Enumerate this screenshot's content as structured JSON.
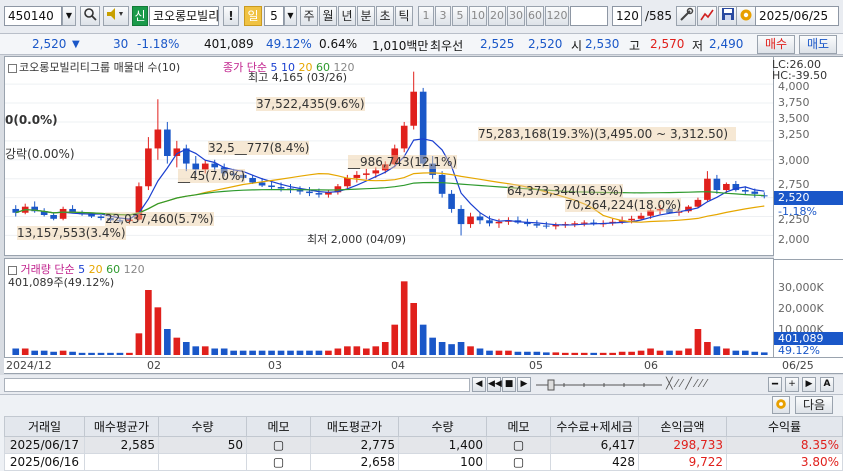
{
  "toolbar": {
    "code": "450140",
    "mode_badge": "신",
    "stock_name": "코오롱모빌리",
    "excl": "!",
    "period_active": "일",
    "period_value": "5",
    "periods": [
      "주",
      "월",
      "년",
      "분",
      "초",
      "틱"
    ],
    "minute_options": [
      "1",
      "3",
      "5",
      "10",
      "20",
      "30",
      "60",
      "120"
    ],
    "counter": "120",
    "counter_total": "/585",
    "date": "2025/06/25"
  },
  "quote": {
    "price": "2,520",
    "arrow": "▼",
    "change": "30",
    "change_pct": "-1.18%",
    "volume": "401,089",
    "vol_ratio": "49.12%",
    "turnover": "0.64%",
    "amount": "1,010백만",
    "best_bid_label": "최우선",
    "best_ask": "2,525",
    "best_bid": "2,520",
    "open_label": "시",
    "open": "2,530",
    "high_label": "고",
    "high": "2,570",
    "low_label": "저",
    "low": "2,490",
    "buy_btn": "매수",
    "sell_btn": "매도"
  },
  "legend": {
    "title": "코오롱모빌리티그룹 매물대 수(10)",
    "ma_label": "종가 단순",
    "ma5": "5",
    "ma10": "10",
    "ma20": "20",
    "ma60": "60",
    "ma120": "120",
    "lc": "LC:26.00",
    "hc": "HC:-39.50"
  },
  "annotations": {
    "high": "최고 4,165 (03/26)",
    "low": "최저 2,000 (04/09)",
    "fall": "강락(0.00%)",
    "left_zero": "0(0.0%)",
    "p1": "37,522,435(9.6%)",
    "p2": "75,283,168(19.3%)(3,495.00 ~ 3,312.50)",
    "p3": "32,5__777(8.4%)",
    "p4": "__986,743(12.1%)",
    "p5": "__45(7.0%)",
    "p6": "64,373,344(16.5%)",
    "p7": "70,264,224(18.0%)",
    "p8": "22,037,460(5.7%)",
    "p9": "13,157,553(3.4%)"
  },
  "price_axis": {
    "ticks": [
      "4,000",
      "3,750",
      "3,500",
      "3,250",
      "3,000",
      "2,750",
      "2,500",
      "2,250",
      "2,000"
    ],
    "current": "2,520",
    "current_pct": "-1.18%"
  },
  "volume_legend": {
    "title": "거래량",
    "ma_label": "단순",
    "ma5": "5",
    "ma20": "20",
    "ma60": "60",
    "ma120": "120",
    "value": "401,089주(49.12%)"
  },
  "volume_axis": {
    "ticks": [
      "30,000K",
      "20,000K",
      "10,000K"
    ],
    "current": "401,089",
    "current_pct": "49.12%"
  },
  "dates": [
    "2024/12",
    "02",
    "03",
    "04",
    "05",
    "06",
    "06/25"
  ],
  "trades": {
    "next_btn": "다음",
    "headers": [
      "거래일",
      "매수평균가",
      "수량",
      "메모",
      "매도평균가",
      "수량",
      "메모",
      "수수료+제세금",
      "손익금액",
      "수익률"
    ],
    "rows": [
      [
        "2025/06/17",
        "2,585",
        "50",
        "",
        "2,775",
        "1,400",
        "",
        "6,417",
        "298,733",
        "8.35%"
      ],
      [
        "2025/06/16",
        "",
        "",
        "",
        "2,658",
        "100",
        "",
        "428",
        "9,722",
        "3.80%"
      ]
    ]
  },
  "colors": {
    "up": "#e0201c",
    "down": "#1a57c8",
    "ma5": "#1a3fd0",
    "ma20": "#e6a700",
    "ma60": "#2e9a2e",
    "ma120": "#888888"
  },
  "chart_data": {
    "type": "candlestick",
    "y_range": [
      1900,
      4200
    ],
    "vol_range": [
      0,
      36000
    ],
    "bars": [
      [
        2350,
        2400,
        2250,
        2300,
        3
      ],
      [
        2300,
        2420,
        2280,
        2380,
        3
      ],
      [
        2380,
        2450,
        2300,
        2320,
        2
      ],
      [
        2320,
        2360,
        2250,
        2270,
        2
      ],
      [
        2270,
        2300,
        2200,
        2220,
        1.5
      ],
      [
        2220,
        2380,
        2200,
        2350,
        2
      ],
      [
        2350,
        2400,
        2290,
        2310,
        1.5
      ],
      [
        2310,
        2330,
        2260,
        2280,
        1
      ],
      [
        2280,
        2300,
        2230,
        2250,
        1
      ],
      [
        2250,
        2270,
        2200,
        2230,
        1
      ],
      [
        2230,
        2260,
        2180,
        2200,
        1
      ],
      [
        2200,
        2230,
        2170,
        2190,
        1
      ],
      [
        2190,
        2230,
        2150,
        2210,
        1
      ],
      [
        2210,
        2700,
        2200,
        2650,
        10
      ],
      [
        2650,
        3300,
        2600,
        3150,
        30
      ],
      [
        3150,
        3800,
        3000,
        3400,
        22
      ],
      [
        3400,
        3500,
        2950,
        3050,
        12
      ],
      [
        3050,
        3250,
        2900,
        3150,
        8
      ],
      [
        3150,
        3200,
        2850,
        2950,
        6
      ],
      [
        2950,
        3050,
        2800,
        2870,
        4
      ],
      [
        2870,
        3000,
        2820,
        2950,
        4
      ],
      [
        2950,
        3000,
        2850,
        2900,
        3
      ],
      [
        2900,
        2950,
        2780,
        2820,
        3
      ],
      [
        2820,
        2880,
        2750,
        2800,
        2
      ],
      [
        2800,
        2850,
        2720,
        2760,
        2
      ],
      [
        2760,
        2800,
        2680,
        2700,
        2
      ],
      [
        2700,
        2760,
        2640,
        2660,
        2
      ],
      [
        2660,
        2720,
        2600,
        2640,
        2
      ],
      [
        2640,
        2700,
        2580,
        2620,
        2
      ],
      [
        2620,
        2680,
        2560,
        2600,
        2
      ],
      [
        2600,
        2650,
        2540,
        2580,
        2
      ],
      [
        2580,
        2640,
        2520,
        2560,
        2
      ],
      [
        2560,
        2620,
        2500,
        2540,
        2
      ],
      [
        2540,
        2600,
        2500,
        2570,
        2
      ],
      [
        2570,
        2680,
        2540,
        2650,
        3
      ],
      [
        2650,
        2800,
        2620,
        2760,
        4
      ],
      [
        2760,
        2850,
        2700,
        2800,
        4
      ],
      [
        2800,
        2880,
        2740,
        2820,
        3
      ],
      [
        2820,
        2900,
        2760,
        2860,
        4
      ],
      [
        2860,
        2980,
        2820,
        2940,
        6
      ],
      [
        2940,
        3200,
        2900,
        3150,
        14
      ],
      [
        3150,
        3500,
        3100,
        3450,
        34
      ],
      [
        3450,
        4165,
        3400,
        3900,
        24
      ],
      [
        3900,
        3950,
        2900,
        2950,
        14
      ],
      [
        2950,
        3050,
        2750,
        2800,
        8
      ],
      [
        2800,
        2850,
        2500,
        2550,
        6
      ],
      [
        2550,
        2600,
        2300,
        2350,
        5
      ],
      [
        2350,
        2400,
        2000,
        2150,
        6
      ],
      [
        2150,
        2300,
        2100,
        2250,
        4
      ],
      [
        2250,
        2300,
        2150,
        2200,
        3
      ],
      [
        2200,
        2260,
        2120,
        2160,
        2
      ],
      [
        2160,
        2220,
        2100,
        2180,
        2
      ],
      [
        2180,
        2240,
        2140,
        2200,
        2
      ],
      [
        2200,
        2250,
        2150,
        2170,
        1.5
      ],
      [
        2170,
        2220,
        2120,
        2150,
        1.5
      ],
      [
        2150,
        2200,
        2100,
        2130,
        1.5
      ],
      [
        2130,
        2180,
        2090,
        2120,
        1.2
      ],
      [
        2120,
        2170,
        2080,
        2140,
        1.2
      ],
      [
        2140,
        2180,
        2100,
        2150,
        1
      ],
      [
        2150,
        2190,
        2110,
        2160,
        1
      ],
      [
        2160,
        2200,
        2120,
        2170,
        1
      ],
      [
        2170,
        2210,
        2130,
        2150,
        1
      ],
      [
        2150,
        2200,
        2110,
        2160,
        1
      ],
      [
        2160,
        2220,
        2130,
        2180,
        1
      ],
      [
        2180,
        2250,
        2150,
        2200,
        1.5
      ],
      [
        2200,
        2260,
        2160,
        2220,
        1.5
      ],
      [
        2220,
        2300,
        2200,
        2260,
        2
      ],
      [
        2260,
        2350,
        2220,
        2330,
        3
      ],
      [
        2330,
        2400,
        2280,
        2350,
        2
      ],
      [
        2350,
        2380,
        2290,
        2300,
        2
      ],
      [
        2300,
        2350,
        2260,
        2320,
        2
      ],
      [
        2320,
        2400,
        2300,
        2380,
        3
      ],
      [
        2380,
        2500,
        2360,
        2470,
        12
      ],
      [
        2470,
        2850,
        2450,
        2750,
        6
      ],
      [
        2750,
        2800,
        2550,
        2600,
        4
      ],
      [
        2600,
        2700,
        2560,
        2680,
        3
      ],
      [
        2680,
        2720,
        2580,
        2600,
        2
      ],
      [
        2600,
        2650,
        2540,
        2580,
        2
      ],
      [
        2580,
        2620,
        2500,
        2550,
        1.5
      ],
      [
        2530,
        2570,
        2490,
        2520,
        1.2
      ]
    ]
  }
}
